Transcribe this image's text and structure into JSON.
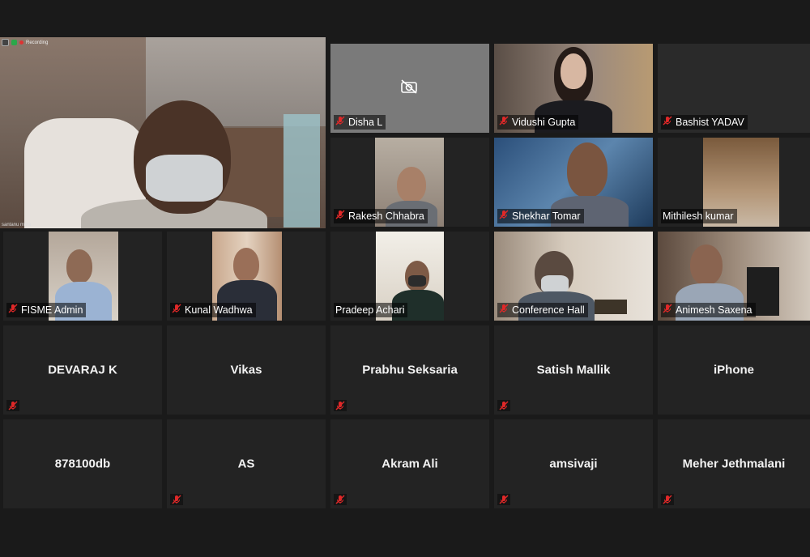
{
  "speaker": {
    "name": "santanu mitra",
    "recording_label": "Recording"
  },
  "video_tiles": [
    {
      "name": "Disha L",
      "muted": true,
      "camera_off": true
    },
    {
      "name": "Vidushi Gupta",
      "muted": true
    },
    {
      "name": "Bashist YADAV",
      "muted": true
    },
    {
      "name": "Rakesh Chhabra",
      "muted": true
    },
    {
      "name": "Shekhar Tomar",
      "muted": true
    },
    {
      "name": "Mithilesh kumar",
      "muted": false
    },
    {
      "name": "FISME Admin",
      "muted": true
    },
    {
      "name": "Kunal Wadhwa",
      "muted": true
    },
    {
      "name": "Pradeep Achari",
      "muted": false
    },
    {
      "name": "Conference Hall",
      "muted": true
    },
    {
      "name": "Animesh Saxena",
      "muted": true
    }
  ],
  "name_tiles": [
    {
      "name": "DEVARAJ K"
    },
    {
      "name": "Vikas"
    },
    {
      "name": "Prabhu Seksaria"
    },
    {
      "name": "Satish Mallik"
    },
    {
      "name": "iPhone"
    },
    {
      "name": "878100db"
    },
    {
      "name": "AS"
    },
    {
      "name": "Akram Ali"
    },
    {
      "name": "amsivaji"
    },
    {
      "name": "Meher Jethmalani"
    }
  ],
  "colors": {
    "muted_red": "#e02828",
    "background": "#1a1a1a",
    "tile": "#232323"
  }
}
